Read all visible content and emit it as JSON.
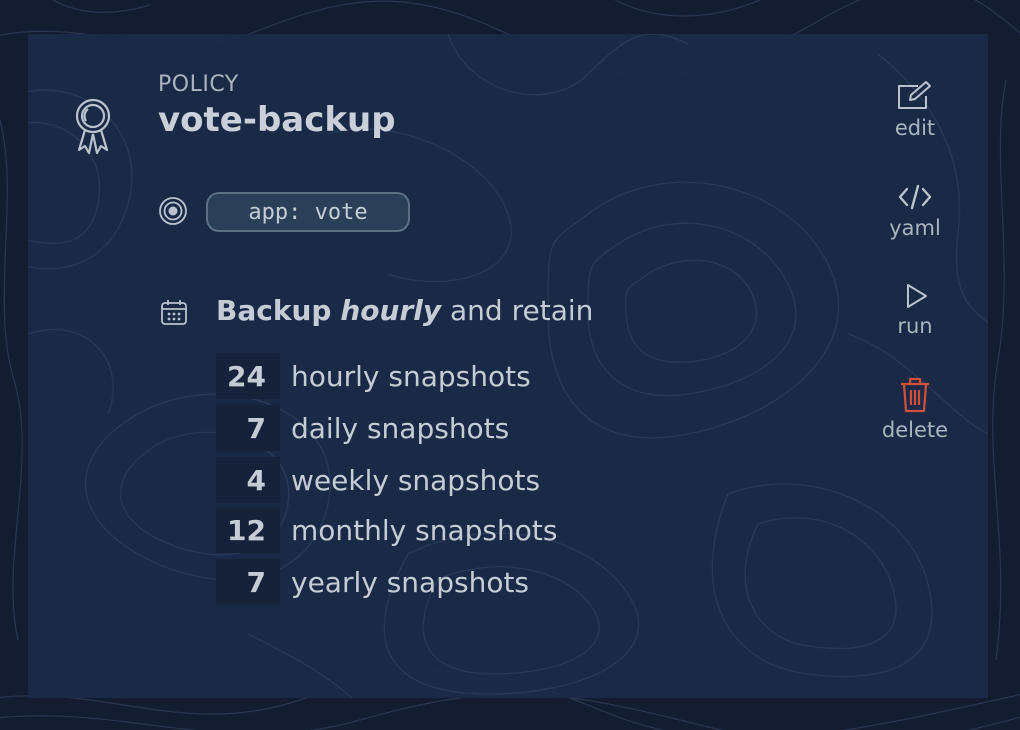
{
  "policy": {
    "kind": "POLICY",
    "name": "vote-backup",
    "selector": "app: vote"
  },
  "schedule": {
    "prefix": "Backup",
    "frequency": "hourly",
    "suffix": "and retain"
  },
  "retention": [
    {
      "count": "24",
      "label": "hourly snapshots"
    },
    {
      "count": "7",
      "label": "daily snapshots"
    },
    {
      "count": "4",
      "label": "weekly snapshots"
    },
    {
      "count": "12",
      "label": "monthly snapshots"
    },
    {
      "count": "7",
      "label": "yearly snapshots"
    }
  ],
  "actions": {
    "edit": "edit",
    "yaml": "yaml",
    "run": "run",
    "delete": "delete"
  },
  "icons": {
    "policy": "award-ribbon-icon",
    "selector": "target-icon",
    "schedule": "calendar-icon",
    "edit": "edit-icon",
    "yaml": "code-icon",
    "run": "play-icon",
    "delete": "trash-icon"
  },
  "colors": {
    "background": "#141d2f",
    "card": "#1b2b48",
    "text": "#c4ccd6",
    "pill": "#2b4058",
    "danger": "#d0503c"
  }
}
